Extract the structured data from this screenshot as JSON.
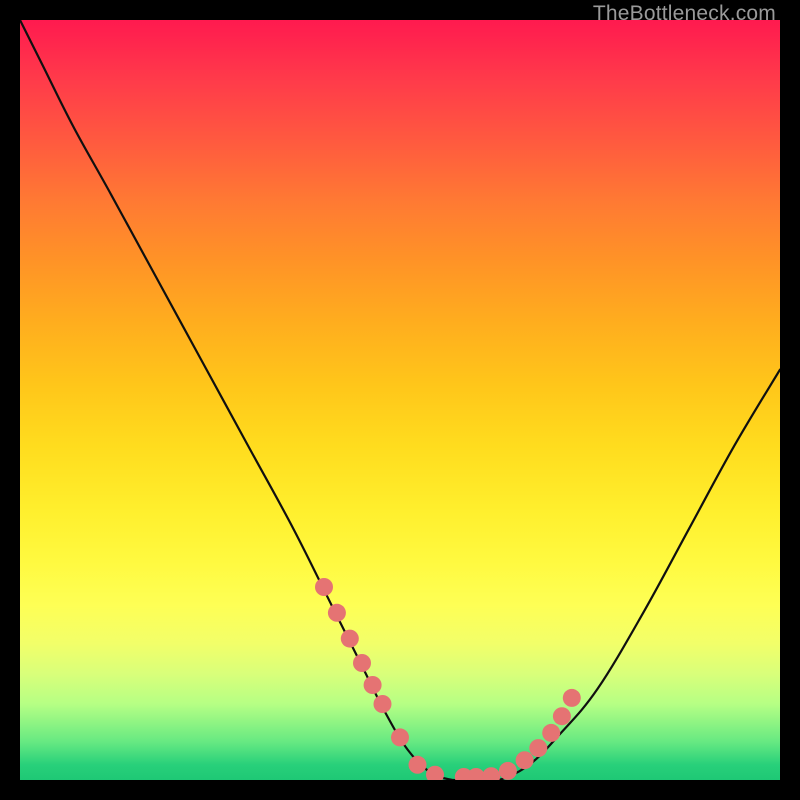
{
  "watermark": "TheBottleneck.com",
  "colors": {
    "background": "#000000",
    "gradient_top": "#ff1a4f",
    "gradient_bottom": "#1ec875",
    "curve": "#101010",
    "dot": "#e57373"
  },
  "chart_data": {
    "type": "line",
    "title": "",
    "xlabel": "",
    "ylabel": "",
    "xlim": [
      0,
      100
    ],
    "ylim": [
      0,
      100
    ],
    "series": [
      {
        "name": "bottleneck-curve",
        "x": [
          0,
          3,
          7,
          12,
          18,
          24,
          30,
          36,
          41,
          45,
          48,
          51,
          54,
          57,
          60,
          63,
          67,
          71,
          76,
          82,
          88,
          94,
          100
        ],
        "y": [
          100,
          94,
          86,
          77,
          66,
          55,
          44,
          33,
          23,
          15,
          9,
          4,
          1,
          0,
          0,
          0,
          2,
          6,
          12,
          22,
          33,
          44,
          54
        ]
      }
    ],
    "markers": {
      "name": "threshold-dots",
      "x": [
        40.0,
        41.7,
        43.4,
        45.0,
        46.4,
        47.7,
        50.0,
        52.3,
        54.6,
        58.4,
        60.0,
        62.0,
        64.2,
        66.4,
        68.2,
        69.9,
        71.3,
        72.6
      ],
      "y": [
        25.4,
        22.0,
        18.6,
        15.4,
        12.5,
        10.0,
        5.6,
        2.0,
        0.7,
        0.4,
        0.4,
        0.5,
        1.2,
        2.6,
        4.2,
        6.2,
        8.4,
        10.8
      ]
    }
  }
}
